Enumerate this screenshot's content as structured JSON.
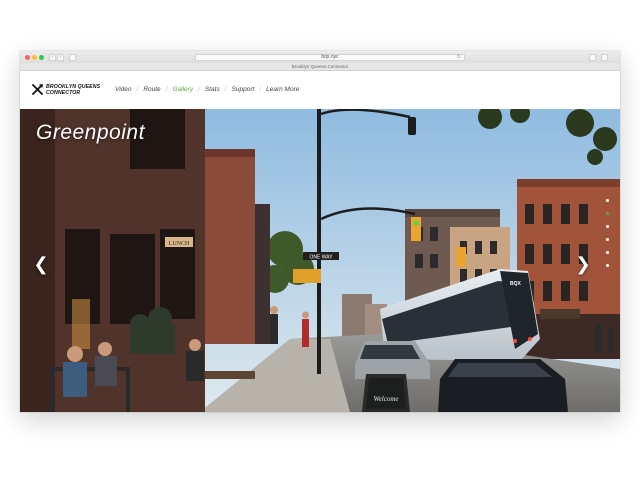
{
  "browser": {
    "url": "bqx.nyc",
    "tab_title": "Brooklyn Queens Connector"
  },
  "brand": {
    "name_line1": "BROOKLYN QUEENS",
    "name_line2": "CONNECTOR",
    "accent_color": "#5aaa3c"
  },
  "nav": {
    "items": [
      {
        "label": "Video"
      },
      {
        "label": "Route"
      },
      {
        "label": "Gallery",
        "active": true
      },
      {
        "label": "Stats"
      },
      {
        "label": "Support"
      },
      {
        "label": "Learn More"
      }
    ],
    "separator": "/"
  },
  "gallery": {
    "title": "Greenpoint",
    "prev_icon": "chevron-left-icon",
    "next_icon": "chevron-right-icon",
    "slide_count": 6,
    "active_slide": 1,
    "scene": {
      "storefront_sign": "LUNCH",
      "street_sign": "ONE WAY",
      "chalkboard": "Welcome",
      "tram_brand": "BQX"
    }
  }
}
